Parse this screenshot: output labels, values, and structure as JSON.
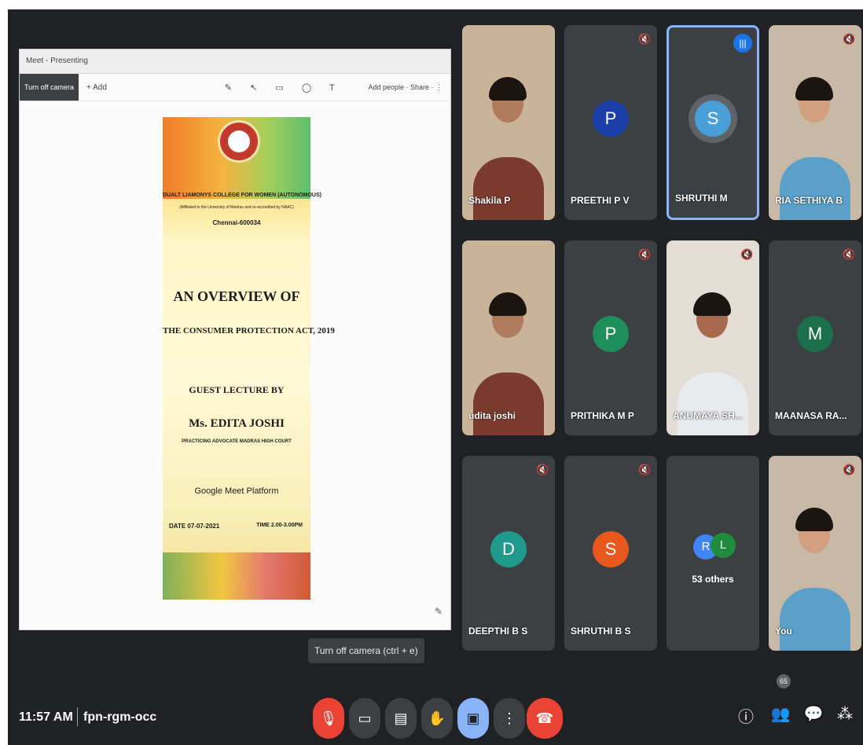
{
  "presentation": {
    "window_title": "Meet - Presenting",
    "toolbar_active": "Turn off camera",
    "toolbar_item": "+ Add",
    "tools": "✎ ↖ ▭ ◯ T",
    "toolbar_right": "Add people · Share · ⋮",
    "poster": {
      "college": "DUALT LIAMONYS COLLEGE FOR WOMEN (AUTONOMOUS)",
      "affiliation": "(Affiliated to the University of Madras and re-accredited by NAAC)",
      "city": "Chennai-600034",
      "title_line1": "AN OVERVIEW OF",
      "title_line2": "THE CONSUMER PROTECTION ACT, 2019",
      "guest_label": "GUEST LECTURE BY",
      "speaker": "Ms. EDITA JOSHI",
      "speaker_role": "PRACTICING ADVOCATE MADRAS HIGH COURT",
      "platform": "Google Meet Platform",
      "date": "DATE 07-07-2021",
      "time": "TIME 2.00-3.00PM"
    }
  },
  "participants": [
    {
      "name": "Shakila P",
      "type": "video",
      "muted": false
    },
    {
      "name": "PREETHI P V",
      "type": "avatar",
      "initial": "P",
      "color": "#1a3fa8",
      "muted": true
    },
    {
      "name": "SHRUTHI M",
      "type": "avatar",
      "initial": "S",
      "color": "#4a9fd8",
      "muted": false,
      "speaking": true
    },
    {
      "name": "RIA SETHIYA B",
      "type": "video",
      "muted": true
    },
    {
      "name": "udita joshi",
      "type": "video",
      "muted": false
    },
    {
      "name": "PRITHIKA M P",
      "type": "avatar",
      "initial": "P",
      "color": "#1e8e5a",
      "muted": true
    },
    {
      "name": "ANUMAYA SH...",
      "type": "video",
      "muted": true
    },
    {
      "name": "MAANASA RA...",
      "type": "avatar",
      "initial": "M",
      "color": "#1b6f4a",
      "muted": true
    },
    {
      "name": "DEEPTHI B S",
      "type": "avatar",
      "initial": "D",
      "color": "#1f9a8c",
      "muted": true
    },
    {
      "name": "SHRUTHI B S",
      "type": "avatar",
      "initial": "S",
      "color": "#e8581c",
      "muted": true
    },
    {
      "name": "53 others",
      "type": "others",
      "initials": [
        "R",
        "L"
      ],
      "colors": [
        "#4285f4",
        "#1e8e3e"
      ]
    },
    {
      "name": "You",
      "type": "video",
      "muted": true
    }
  ],
  "tooltip": "Turn off camera (ctrl + e)",
  "bottom_bar": {
    "time": "11:57 AM",
    "meeting_code": "fpn-rgm-occ",
    "participant_count": "65"
  },
  "colors": {
    "background": "#202124",
    "tile": "#3c4043",
    "danger": "#ea4335",
    "accent": "#8ab4f8"
  }
}
